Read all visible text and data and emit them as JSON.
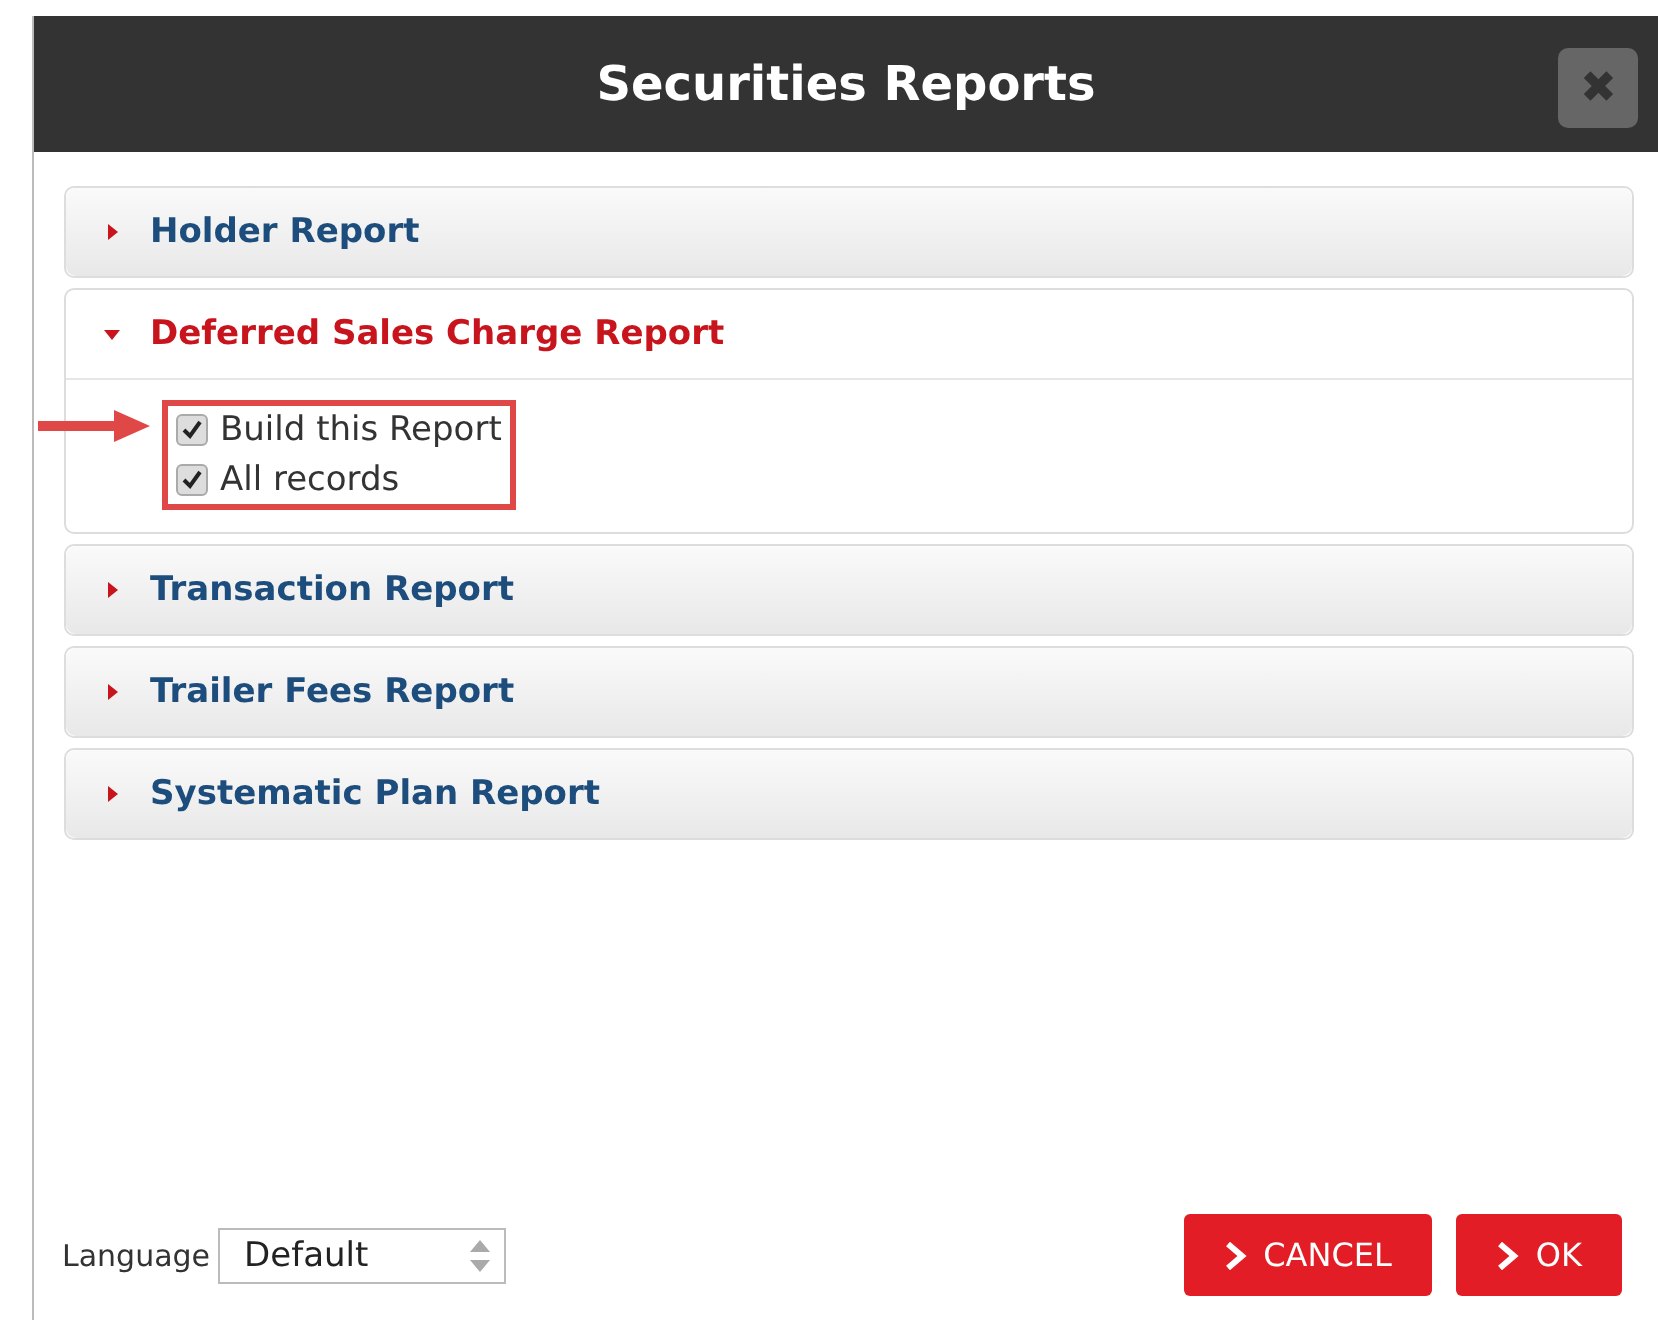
{
  "window": {
    "title": "Securities Reports",
    "close": "✖"
  },
  "sections": [
    {
      "label": "Holder Report",
      "expanded": false
    },
    {
      "label": "Deferred Sales Charge Report",
      "expanded": true,
      "options": [
        {
          "label": "Build this Report",
          "checked": true
        },
        {
          "label": "All records",
          "checked": true
        }
      ]
    },
    {
      "label": "Transaction Report",
      "expanded": false
    },
    {
      "label": "Trailer Fees Report",
      "expanded": false
    },
    {
      "label": "Systematic Plan Report",
      "expanded": false
    }
  ],
  "language": {
    "label": "Language",
    "value": "Default"
  },
  "buttons": [
    {
      "label": "CANCEL"
    },
    {
      "label": "OK"
    }
  ]
}
